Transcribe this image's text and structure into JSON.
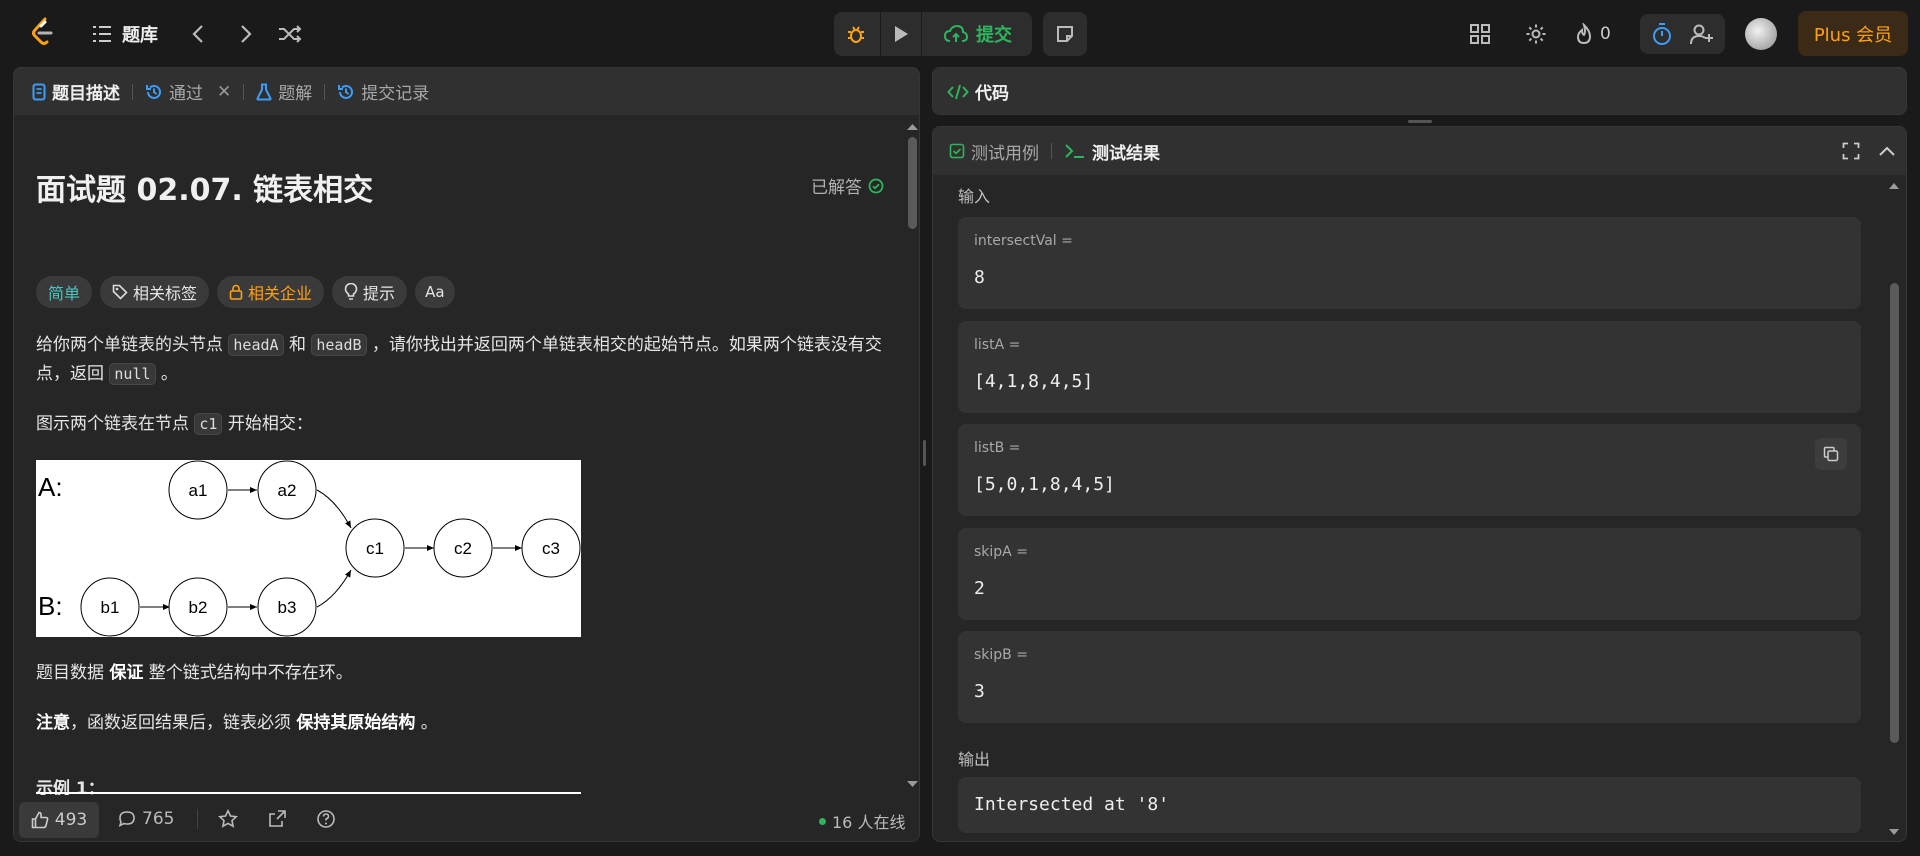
{
  "topbar": {
    "problems_label": "题库",
    "submit_label": "提交",
    "streak_count": "0",
    "plus_label": "Plus 会员"
  },
  "left": {
    "tabs": [
      {
        "label": "题目描述"
      },
      {
        "label": "通过"
      },
      {
        "label": "题解"
      },
      {
        "label": "提交记录"
      }
    ],
    "title": "面试题 02.07. 链表相交",
    "solved_label": "已解答",
    "tags": {
      "difficulty": "简单",
      "related_tags": "相关标签",
      "related_companies": "相关企业",
      "hint": "提示",
      "font": "Aa"
    },
    "desc": {
      "p1_a": "给你两个单链表的头节点 ",
      "p1_code1": "headA",
      "p1_b": " 和 ",
      "p1_code2": "headB",
      "p1_c": " ，请你找出并返回两个单链表相交的起始节点。如果两个链表没有交点，返回 ",
      "p1_code3": "null",
      "p1_d": " 。",
      "p2_a": "图示两个链表在节点 ",
      "p2_code": "c1",
      "p2_b": " 开始相交：",
      "p3_a": "题目数据 ",
      "p3_b": "保证",
      "p3_c": " 整个链式结构中不存在环。",
      "p4_a": "注意",
      "p4_b": "，函数返回结果后，链表必须 ",
      "p4_c": "保持其原始结构",
      "p4_d": " 。",
      "example_heading": "示例 1："
    },
    "diagram": {
      "label_a": "A:",
      "label_b": "B:",
      "nodes": [
        "a1",
        "a2",
        "c1",
        "c2",
        "c3",
        "b1",
        "b2",
        "b3"
      ]
    },
    "footer": {
      "likes": "493",
      "comments": "765",
      "online": "16 人在线"
    }
  },
  "code_panel": {
    "tab_label": "代码"
  },
  "test_panel": {
    "tab_cases": "测试用例",
    "tab_results": "测试结果",
    "input_label": "输入",
    "output_label": "输出",
    "fields": [
      {
        "name": "intersectVal =",
        "value": "8"
      },
      {
        "name": "listA =",
        "value": "[4,1,8,4,5]"
      },
      {
        "name": "listB =",
        "value": "[5,0,1,8,4,5]"
      },
      {
        "name": "skipA =",
        "value": "2"
      },
      {
        "name": "skipB =",
        "value": "3"
      }
    ],
    "output_value": "Intersected at '8'"
  }
}
